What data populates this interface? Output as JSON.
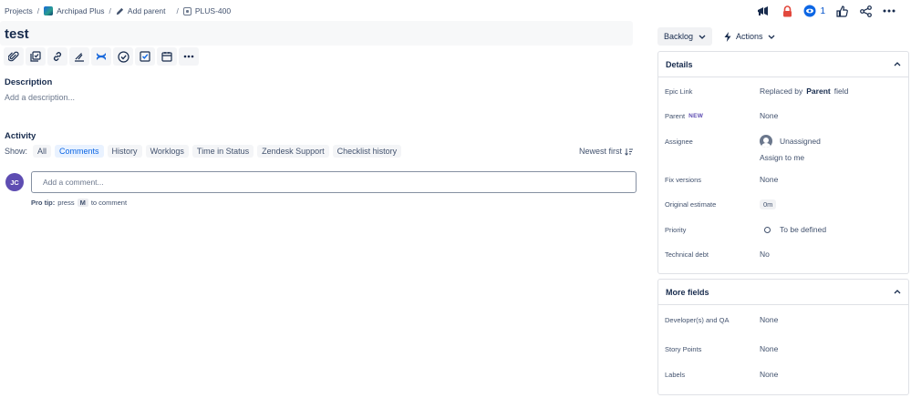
{
  "breadcrumb": {
    "projects": "Projects",
    "project": "Archipad Plus",
    "add_parent": "Add parent",
    "issue_key": "PLUS-400"
  },
  "header": {
    "watch_count": "1"
  },
  "issue": {
    "title": "test"
  },
  "description": {
    "label": "Description",
    "placeholder": "Add a description..."
  },
  "activity": {
    "label": "Activity",
    "show_label": "Show:",
    "filters": [
      "All",
      "Comments",
      "History",
      "Worklogs",
      "Time in Status",
      "Zendesk Support",
      "Checklist history"
    ],
    "active_filter": "Comments",
    "sort_label": "Newest first",
    "avatar_initials": "JC",
    "comment_placeholder": "Add a comment...",
    "pro_tip_label": "Pro tip:",
    "pro_tip_press": "press",
    "pro_tip_key": "M",
    "pro_tip_suffix": "to comment"
  },
  "sidebar": {
    "status": "Backlog",
    "actions": "Actions",
    "details": {
      "title": "Details",
      "epic_link_label": "Epic Link",
      "epic_link_value_prefix": "Replaced by",
      "epic_link_value_bold": "Parent",
      "epic_link_value_suffix": "field",
      "parent_label": "Parent",
      "parent_badge": "NEW",
      "parent_value": "None",
      "assignee_label": "Assignee",
      "assignee_value": "Unassigned",
      "assign_to_me": "Assign to me",
      "fix_versions_label": "Fix versions",
      "fix_versions_value": "None",
      "original_estimate_label": "Original estimate",
      "original_estimate_value": "0m",
      "priority_label": "Priority",
      "priority_value": "To be defined",
      "tech_debt_label": "Technical debt",
      "tech_debt_value": "No"
    },
    "more_fields": {
      "title": "More fields",
      "dev_qa_label": "Developer(s) and QA",
      "dev_qa_value": "None",
      "story_points_label": "Story Points",
      "story_points_value": "None",
      "labels_label": "Labels",
      "labels_value": "None"
    }
  },
  "colors": {
    "accent": "#0c66e4",
    "lock": "#e2483d",
    "avatar": "#5e4db2"
  }
}
